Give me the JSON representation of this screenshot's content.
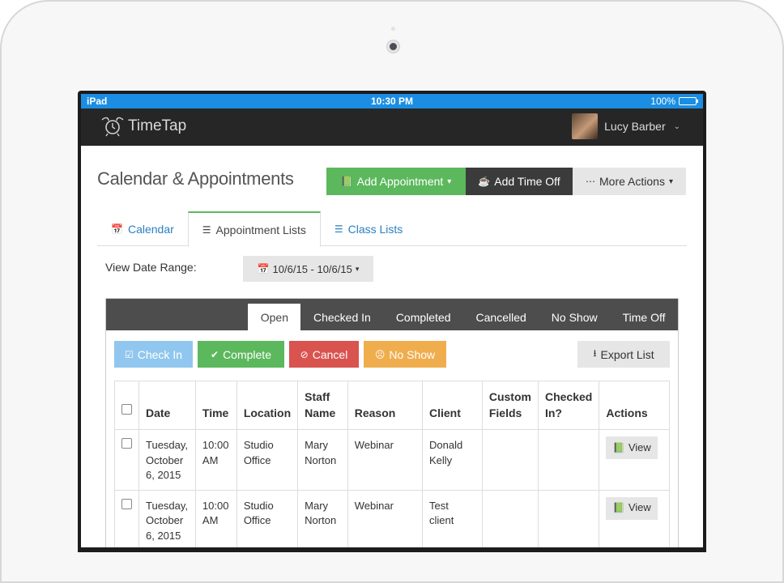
{
  "status_bar": {
    "carrier": "iPad",
    "time": "10:30 PM",
    "battery": "100%",
    "battery_level": 1.0
  },
  "topnav": {
    "logo_text": "TimeTap",
    "user_name": "Lucy Barber"
  },
  "page": {
    "title": "Calendar & Appointments",
    "add_appointment": "Add Appointment",
    "add_time_off": "Add Time Off",
    "more_actions": "More Actions"
  },
  "tabs": [
    {
      "label": "Calendar"
    },
    {
      "label": "Appointment Lists"
    },
    {
      "label": "Class Lists"
    }
  ],
  "date_range": {
    "label": "View Date Range:",
    "value": "10/6/15 - 10/6/15"
  },
  "status_tabs": [
    "Open",
    "Checked In",
    "Completed",
    "Cancelled",
    "No Show",
    "Time Off"
  ],
  "bulk_actions": {
    "check_in": "Check In",
    "complete": "Complete",
    "cancel": "Cancel",
    "no_show": "No Show",
    "export": "Export List"
  },
  "table": {
    "headers": {
      "date": "Date",
      "time": "Time",
      "location": "Location",
      "staff_line1": "Staff",
      "staff_line2": "Name",
      "reason": "Reason",
      "client": "Client",
      "custom_line1": "Custom",
      "custom_line2": "Fields",
      "checked_line1": "Checked",
      "checked_line2": "In?",
      "actions": "Actions"
    },
    "rows": [
      {
        "date1": "Tuesday,",
        "date2": "October",
        "date3": "6, 2015",
        "time1": "10:00",
        "time2": "AM",
        "loc1": "Studio",
        "loc2": "Office",
        "staff1": "Mary",
        "staff2": "Norton",
        "reason": "Webinar",
        "client1": "Donald",
        "client2": "Kelly",
        "view": "View"
      },
      {
        "date1": "Tuesday,",
        "date2": "October",
        "date3": "6, 2015",
        "time1": "10:00",
        "time2": "AM",
        "loc1": "Studio",
        "loc2": "Office",
        "staff1": "Mary",
        "staff2": "Norton",
        "reason": "Webinar",
        "client1": "Test",
        "client2": "client",
        "view": "View"
      }
    ]
  },
  "colors": {
    "status_bar": "#1b8ee3",
    "nav": "#262626",
    "success": "#5cb85c",
    "danger": "#d9534f",
    "warning": "#f0ad4e",
    "info": "#91c7ee",
    "link": "#2a7fc0"
  }
}
